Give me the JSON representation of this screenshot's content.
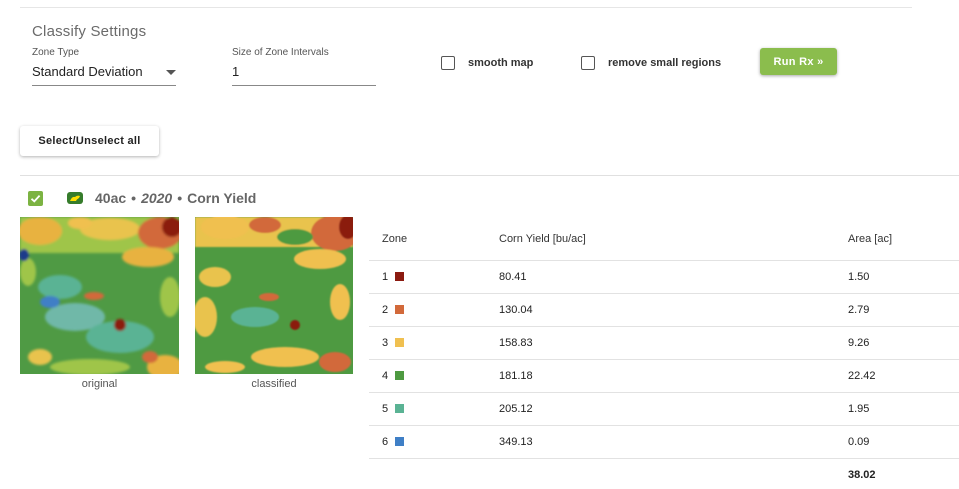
{
  "settings": {
    "title": "Classify Settings",
    "zone_type_label": "Zone Type",
    "zone_type_value": "Standard Deviation",
    "interval_label": "Size of Zone Intervals",
    "interval_value": "1",
    "smooth_map_label": "smooth map",
    "smooth_map_checked": false,
    "remove_small_label": "remove small regions",
    "remove_small_checked": false,
    "run_button_label": "Run Rx »",
    "run_button_color": "#8bbd4d"
  },
  "select_all_label": "Select/Unselect all",
  "field": {
    "checked": true,
    "name": "40ac",
    "separator": "•",
    "year": "2020",
    "layer": "Corn Yield",
    "check_color": "#7cb342",
    "logo_color": "#367c2b"
  },
  "maps": {
    "original_caption": "original",
    "classified_caption": "classified"
  },
  "table": {
    "headers": {
      "zone": "Zone",
      "yield": "Corn Yield [bu/ac]",
      "area": "Area [ac]"
    },
    "rows": [
      {
        "zone": "1",
        "color": "#8b1a10",
        "yield": "80.41",
        "area": "1.50"
      },
      {
        "zone": "2",
        "color": "#d2693a",
        "yield": "130.04",
        "area": "2.79"
      },
      {
        "zone": "3",
        "color": "#f0c050",
        "yield": "158.83",
        "area": "9.26"
      },
      {
        "zone": "4",
        "color": "#4e9a41",
        "yield": "181.18",
        "area": "22.42"
      },
      {
        "zone": "5",
        "color": "#5ab394",
        "yield": "205.12",
        "area": "1.95"
      },
      {
        "zone": "6",
        "color": "#3f7fc6",
        "yield": "349.13",
        "area": "0.09"
      }
    ],
    "total_area": "38.02"
  }
}
